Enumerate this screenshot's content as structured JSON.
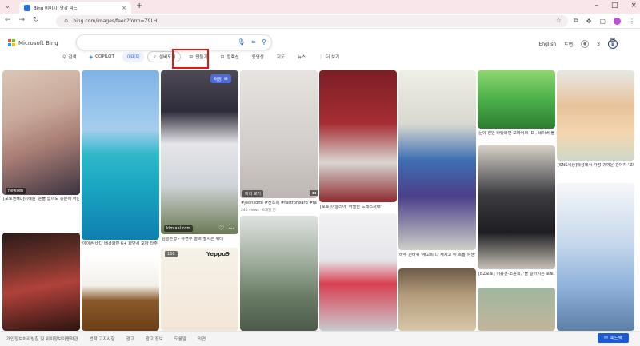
{
  "browser": {
    "tab_title": "Bing 이미지: 영감 피드",
    "url": "bing.com/images/feed?form=Z9LH"
  },
  "header": {
    "logo_text": "Microsoft Bing",
    "language": "English",
    "user_name": "도연",
    "rewards_count": "3"
  },
  "scopes": [
    {
      "label": "검색",
      "icon": "search-icon"
    },
    {
      "label": "COPILOT",
      "icon": "copilot-icon"
    },
    {
      "label": "이미지",
      "icon": "",
      "active": true
    },
    {
      "label": "실버포기",
      "icon": "check-icon"
    },
    {
      "label": "만들기",
      "icon": "create-icon"
    },
    {
      "label": "컬렉션",
      "icon": "collection-icon"
    },
    {
      "label": "동영상",
      "icon": ""
    },
    {
      "label": "지도",
      "icon": ""
    },
    {
      "label": "뉴스",
      "icon": ""
    },
    {
      "label": "더 보기",
      "icon": "more-icon"
    }
  ],
  "tiles": {
    "t1": "[포토엔HD]이혜원 '눈물 없이도 충분히 아찬 하체' - 순애 '잘 하드 뮤스 동...'",
    "t1_source": "newsen",
    "t3_caption": "김할돈형 - 유현주 골퍼 옆치는 뒤태",
    "t3_source": "kimjaal.com",
    "t4_tag": "미리 보기",
    "t4_caption": "#jeonsomi #전소미 #fastforward #fastforwardchallenge @YesStyle...",
    "t4_meta": "245 views · 6개월 전",
    "t5_caption": "[포토]이엘리아 '아찔한 드레스자태'",
    "t6_caption": "바주 손바퀴 '재고피 다 재치고 이 옥팔 여생인' - 이시아경제",
    "t7_caption": "눈이 편안 바탕화면 모마이의 :D , 네이버 블로그",
    "t8_caption": "[BZ포토] 이동건·조윤희, '물 알아지는 포토' - 이포이미",
    "t9_caption": "[SNS세상]해성에서 가장 귀여운 강아지 '포메로' 뜨끈해인지 코넛지 | YTN",
    "t10_caption": "아이폰 바다 배경화면 6+ 화면세 모아 타주세요 - 1시 VIN",
    "t11_badge": "160",
    "t11_brand": "Yeppu9",
    "save_label": "저장"
  },
  "footer": {
    "links": [
      "개인정보처리방침 및 위치정보이용약관",
      "법적 고지사항",
      "광고",
      "광고 정보",
      "도움말",
      "의견"
    ],
    "feedback": "피드백"
  }
}
